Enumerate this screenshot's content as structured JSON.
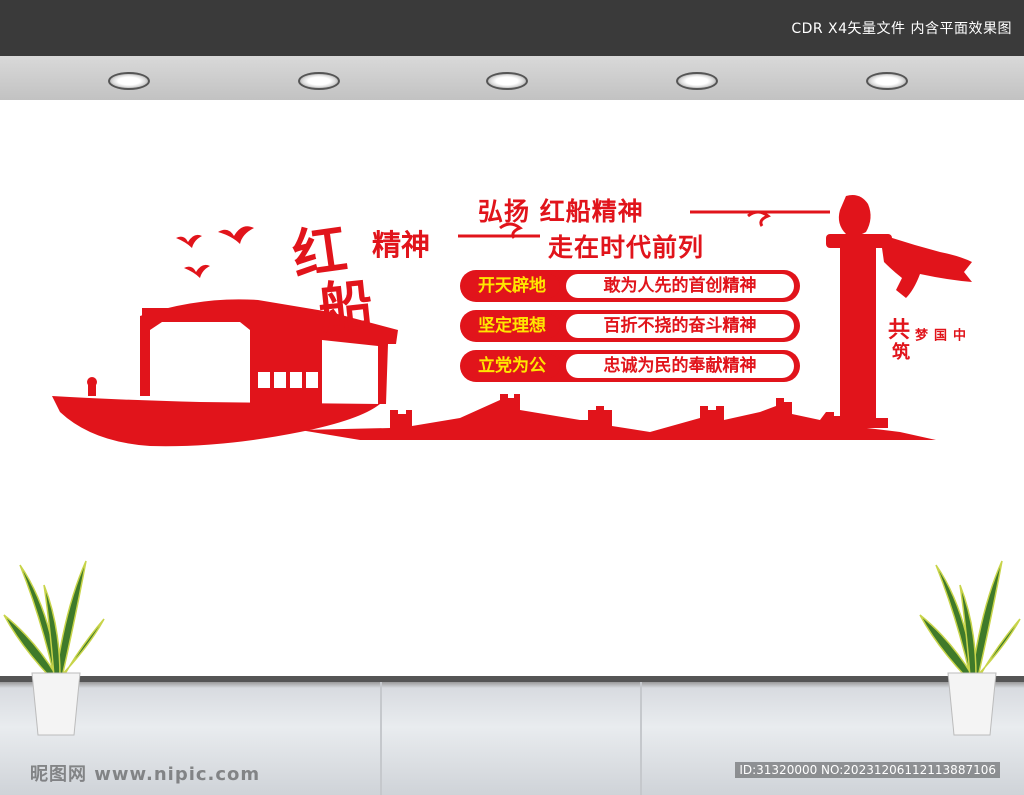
{
  "header": {
    "caption": "CDR X4矢量文件  内含平面效果图"
  },
  "mural": {
    "title_calligraphy_1": "红",
    "title_calligraphy_2": "船",
    "title_suffix": "精神",
    "slogan_line1": "弘扬 红船精神",
    "slogan_line2": "走在时代前列",
    "rows": [
      {
        "left": "开天辟地",
        "right": "敢为人先的首创精神"
      },
      {
        "left": "坚定理想",
        "right": "百折不挠的奋斗精神"
      },
      {
        "left": "立党为公",
        "right": "忠诚为民的奉献精神"
      }
    ],
    "side_text_1": "共",
    "side_text_2": "筑",
    "side_text_3": "中国梦",
    "colors": {
      "red": "#e1141b",
      "yellow": "#ffe600"
    }
  },
  "watermark": {
    "site": "昵图网 www.nipic.com",
    "id": "ID:31320000 NO:20231206112113887106"
  }
}
